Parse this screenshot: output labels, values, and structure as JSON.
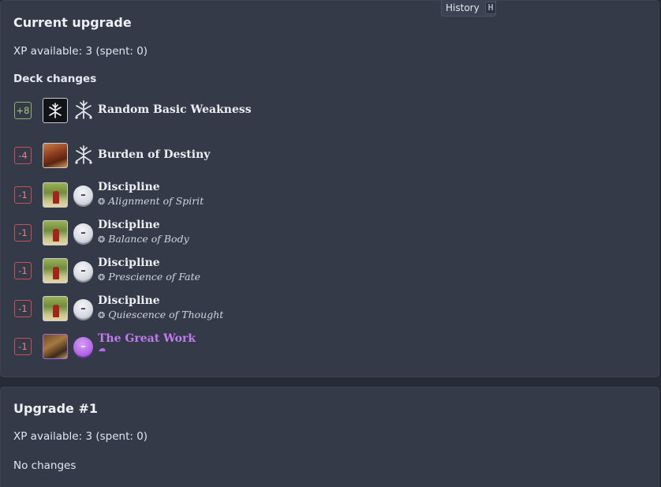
{
  "history": {
    "label": "History",
    "shortcut": "H"
  },
  "current": {
    "title": "Current upgrade",
    "xp_line": "XP available: 3 (spent: 0)",
    "deck_changes_title": "Deck changes",
    "rows": [
      {
        "qty": "+8",
        "name": "Random Basic Weakness",
        "subtitle": "",
        "icon": "weakness-glyph-icon"
      },
      {
        "qty": "-4",
        "name": "Burden of Destiny",
        "subtitle": "",
        "icon": "weakness-glyph-icon"
      },
      {
        "qty": "-1",
        "name": "Discipline",
        "subtitle": "Alignment of Spirit",
        "seal": "–"
      },
      {
        "qty": "-1",
        "name": "Discipline",
        "subtitle": "Balance of Body",
        "seal": "–"
      },
      {
        "qty": "-1",
        "name": "Discipline",
        "subtitle": "Prescience of Fate",
        "seal": "–"
      },
      {
        "qty": "-1",
        "name": "Discipline",
        "subtitle": "Quiescence of Thought",
        "seal": "–"
      },
      {
        "qty": "-1",
        "name": "The Great Work",
        "subtitle": "",
        "seal": "–"
      }
    ]
  },
  "upgrade1": {
    "title": "Upgrade #1",
    "xp_line": "XP available: 3 (spent: 0)",
    "no_changes": "No changes"
  },
  "colors": {
    "panel_bg": "#343a48",
    "page_bg": "#262b36",
    "negative": "#c3525e",
    "positive": "#8fb171",
    "mystic_purple": "#c07bf0"
  }
}
